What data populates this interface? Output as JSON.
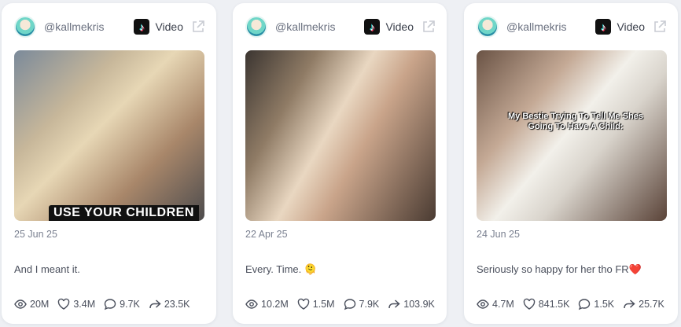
{
  "cards": [
    {
      "handle": "@kallmekris",
      "platform_label": "Video",
      "media_overlay": "USE YOUR CHILDREN",
      "date": "25 Jun 25",
      "text": "And I meant it.",
      "views": "20M",
      "likes": "3.4M",
      "comments": "9.7K",
      "shares": "23.5K"
    },
    {
      "handle": "@kallmekris",
      "platform_label": "Video",
      "date": "22 Apr 25",
      "text": "Every. Time. 🫠",
      "views": "10.2M",
      "likes": "1.5M",
      "comments": "7.9K",
      "shares": "103.9K"
    },
    {
      "handle": "@kallmekris",
      "platform_label": "Video",
      "media_overlay": "My Bestie Trying To Tell Me Shes Going To Have A Child:",
      "date": "24 Jun 25",
      "text": "Seriously so happy for her tho FR❤️",
      "views": "4.7M",
      "likes": "841.5K",
      "comments": "1.5K",
      "shares": "25.7K"
    }
  ],
  "icons": {
    "platform": "tiktok-icon",
    "external": "external-link-icon",
    "views": "eye-icon",
    "likes": "heart-icon",
    "comments": "comment-icon",
    "shares": "share-icon"
  },
  "colors": {
    "background": "#eef0f4",
    "card": "#ffffff",
    "text": "#4a4f5c",
    "muted": "#7a8090",
    "accent_pink": "#e8315f"
  }
}
